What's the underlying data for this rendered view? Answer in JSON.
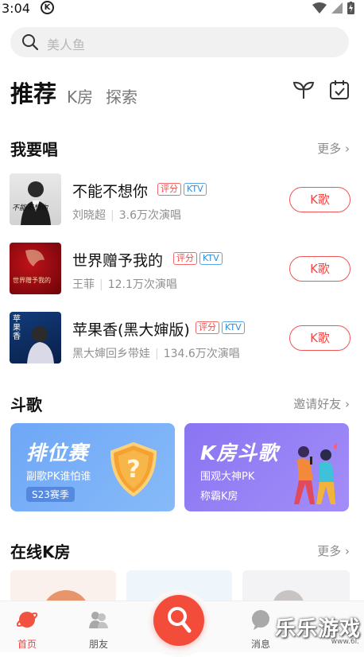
{
  "status": {
    "time": "3:04",
    "logo": "K"
  },
  "search": {
    "placeholder": "美人鱼"
  },
  "tabs": {
    "main": "推荐",
    "k_room": "K房",
    "explore": "探索"
  },
  "sing_section": {
    "title": "我要唱",
    "more": "更多 ›"
  },
  "songs": [
    {
      "title": "不能不想你",
      "badge_score": "评分",
      "badge_ktv": "KTV",
      "artist": "刘晓超",
      "plays": "3.6万次演唱",
      "button": "K歌",
      "cover_text": "不能不想你"
    },
    {
      "title": "世界赠予我的",
      "badge_score": "评分",
      "badge_ktv": "KTV",
      "artist": "王菲",
      "plays": "12.1万次演唱",
      "button": "K歌",
      "cover_text": "世界赠予我的"
    },
    {
      "title": "苹果香(黑大婶版)",
      "badge_score": "评分",
      "badge_ktv": "KTV",
      "artist": "黑大婶回乡带娃",
      "plays": "134.6万次演唱",
      "button": "K歌",
      "cover_text": "苹果香"
    }
  ],
  "battle_section": {
    "title": "斗歌",
    "more": "邀请好友 ›"
  },
  "battle_cards": [
    {
      "title": "排位赛",
      "subtitle": "副歌PK谁怕谁",
      "tag": "S23赛季"
    },
    {
      "title": "K房斗歌",
      "subtitle": "围观大神PK",
      "subtitle2": "称霸K房"
    }
  ],
  "online_section": {
    "title": "在线K房",
    "more": "更多 ›"
  },
  "bottom_nav": {
    "home": "首页",
    "friends": "朋友",
    "messages": "消息"
  },
  "watermark": {
    "text": "乐乐游戏",
    "url": "www.6l."
  },
  "colors": {
    "accent": "#f34c3b",
    "ktv_blue": "#2f8bd9",
    "card_blue": "#7aaff7",
    "card_purple": "#957ff5"
  }
}
